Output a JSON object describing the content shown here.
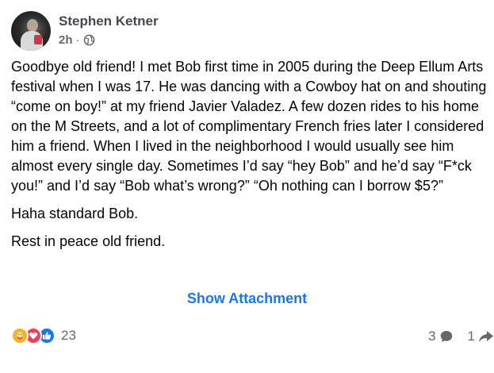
{
  "post": {
    "author": "Stephen Ketner",
    "time": "2h",
    "separator": "·",
    "audience_icon": "globe-icon",
    "paragraphs": [
      "Goodbye old friend! I met Bob first time in 2005 during the Deep Ellum Arts festival when I was 17. He was dancing with a Cowboy hat on and shouting “come on boy!” at my friend Javier Valadez. A few dozen rides to his home on the M Streets, and a lot of complimentary French fries later I considered him a friend. When I lived in the neighborhood I would usually see him almost every single day. Sometimes I’d say “hey Bob” and he’d say “F*ck you!” and I’d say “Bob what’s wrong?” “Oh nothing can I borrow $5?”",
      "Haha standard Bob.",
      "Rest in peace old friend."
    ],
    "attachment_label": "Show Attachment"
  },
  "footer": {
    "reactions": [
      "care-icon",
      "love-icon",
      "like-icon"
    ],
    "reaction_count": "23",
    "comment_count": "3",
    "comment_icon": "comment-icon",
    "share_count": "1",
    "share_icon": "share-icon"
  },
  "colors": {
    "accent": "#1877f2",
    "text": "#050505",
    "muted": "#65676b",
    "love": "#f33e58",
    "care": "#f7b125",
    "like": "#1877f2"
  }
}
